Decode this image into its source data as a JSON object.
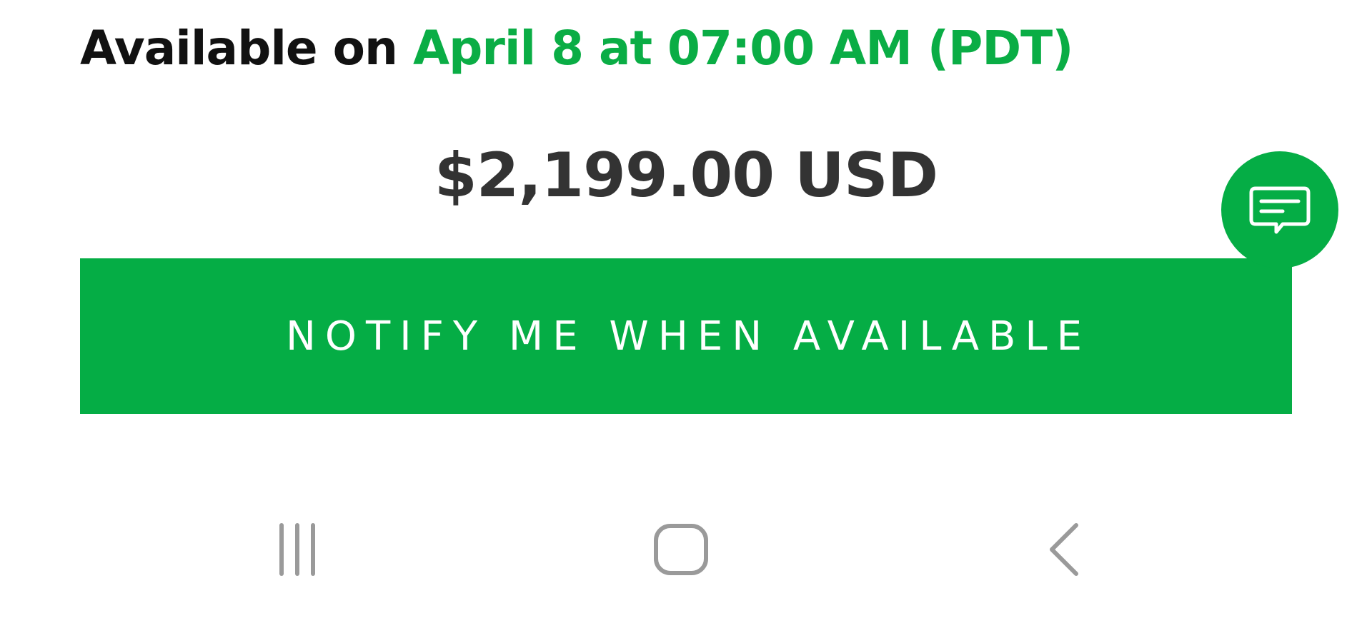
{
  "availability": {
    "lead_text": "Available on",
    "date_text": "April 8 at 07:00 AM (PDT)"
  },
  "product": {
    "price": "$2,199.00 USD"
  },
  "actions": {
    "notify_label": "NOTIFY ME WHEN AVAILABLE",
    "chat_icon": "chat-bubble-icon"
  },
  "system_nav": {
    "recents_icon": "recent-apps-icon",
    "home_icon": "home-icon",
    "back_icon": "back-icon"
  },
  "colors": {
    "accent_green": "#05ad45",
    "text_dark": "#111111",
    "price_text": "#333333",
    "nav_icon": "#9a9a9a"
  }
}
